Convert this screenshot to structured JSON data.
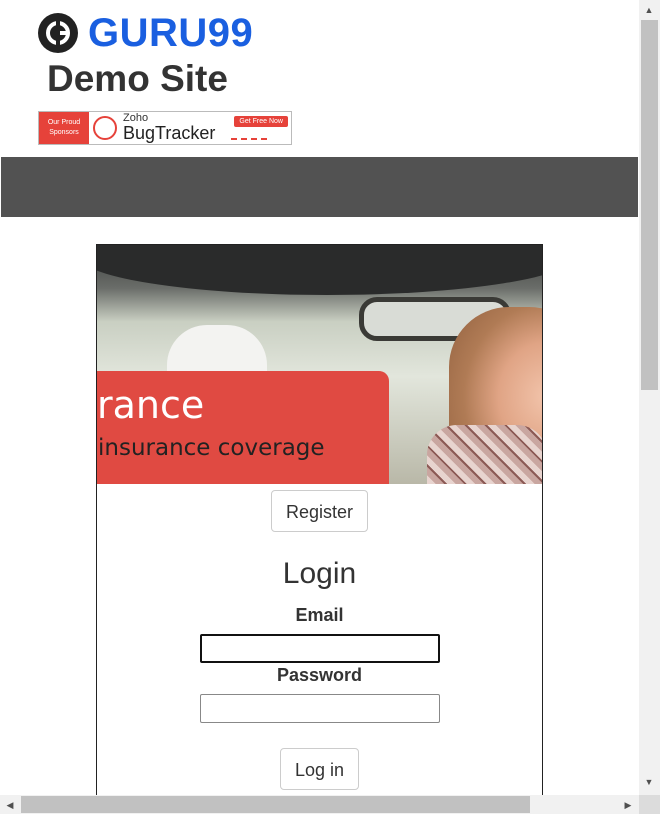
{
  "header": {
    "logo_text": "GURU99",
    "site_title": "Demo Site"
  },
  "sponsor_banner": {
    "label": "Our Proud Sponsors",
    "brand_small": "Zoho",
    "brand_big": "BugTracker",
    "cta": "Get Free Now"
  },
  "hero": {
    "title": "rance",
    "subtitle": "insurance coverage"
  },
  "actions": {
    "register_label": "Register"
  },
  "login": {
    "heading": "Login",
    "email_label": "Email",
    "email_value": "",
    "password_label": "Password",
    "password_value": "",
    "submit_label": "Log in"
  },
  "colors": {
    "navbar": "#525252",
    "brand_blue": "#1a5fe0",
    "promo_red": "#e04a42"
  }
}
